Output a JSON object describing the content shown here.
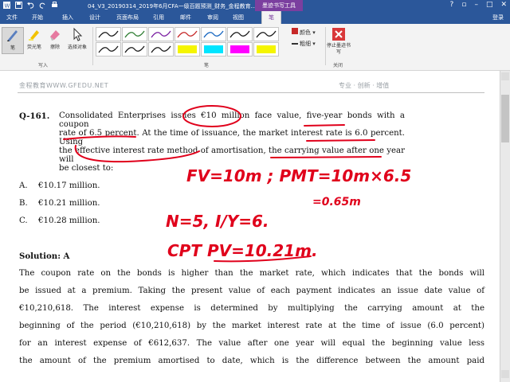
{
  "titlebar": {
    "doc_title": "04_V3_20190314_2019年6月CFA一级百题预测_财务_金程教育...",
    "context_tool": "墨迹书写工具",
    "icons": [
      "word-icon",
      "save-icon",
      "undo-icon",
      "redo-icon",
      "print-icon"
    ]
  },
  "tabs": {
    "file": "文件",
    "items": [
      "开始",
      "插入",
      "设计",
      "页面布局",
      "引用",
      "邮件",
      "审阅",
      "视图"
    ],
    "active": "笔",
    "login": "登录"
  },
  "ribbon": {
    "tools": [
      {
        "label": "笔",
        "icon": "pen-icon"
      },
      {
        "label": "荧光笔",
        "icon": "highlighter-icon"
      },
      {
        "label": "擦除",
        "icon": "eraser-icon"
      },
      {
        "label": "选择对象",
        "icon": "select-objects-icon"
      }
    ],
    "group_write": "写入",
    "group_pens": "笔",
    "group_close": "关闭",
    "color_label": "颜色",
    "thickness_label": "粗细",
    "stop_ink": "停止墨迹书写",
    "pen_colors": [
      "#1a1a1a",
      "#2e7d32",
      "#7b1fa2",
      "#c62828",
      "#1565c0",
      "#1a1a1a",
      "#1a1a1a",
      "#1a1a1a",
      "#1a1a1a",
      "#1a1a1a",
      "#f5f500",
      "#00e5ff",
      "#ff00ff",
      "#f5f500",
      "#00e5ff"
    ]
  },
  "document": {
    "header_left": "金程教育WWW.GFEDU.NET",
    "header_right": "专业 · 创新 · 增值",
    "question_id": "Q-161.",
    "question_lines": [
      "Consolidated Enterprises issues €10 million face value, five-year bonds with a coupon",
      "rate of 6.5 percent. At the time of issuance, the market interest rate is 6.0 percent. Using",
      "the effective interest rate method of amortisation, the carrying value after one year will",
      "be closest to:"
    ],
    "options": [
      {
        "letter": "A.",
        "text": "€10.17 million."
      },
      {
        "letter": "B.",
        "text": "€10.21 million."
      },
      {
        "letter": "C.",
        "text": "€10.28 million."
      }
    ],
    "solution_title": "Solution: A",
    "solution_lines": [
      "The coupon rate on the bonds is higher than the market rate, which indicates that the bonds will",
      "be issued at a premium. Taking the present value of each payment indicates an issue date value of",
      "€10,210,618. The interest expense is determined by multiplying the carrying amount at the",
      "beginning of the period (€10,210,618) by the market interest rate at the time of issue (6.0 percent)",
      "for an interest expense of €612,637. The value after one year will equal the beginning value less",
      "the amount of the premium amortised to date, which is the difference between the amount paid"
    ]
  },
  "ink_annotations": {
    "line1": "FV=10m ;  PMT=10m×6.5",
    "line2": "=0.65m",
    "line3": "N=5,  I/Y=6.",
    "line4": "CPT  PV=10.21m.",
    "color": "#e0001b"
  }
}
